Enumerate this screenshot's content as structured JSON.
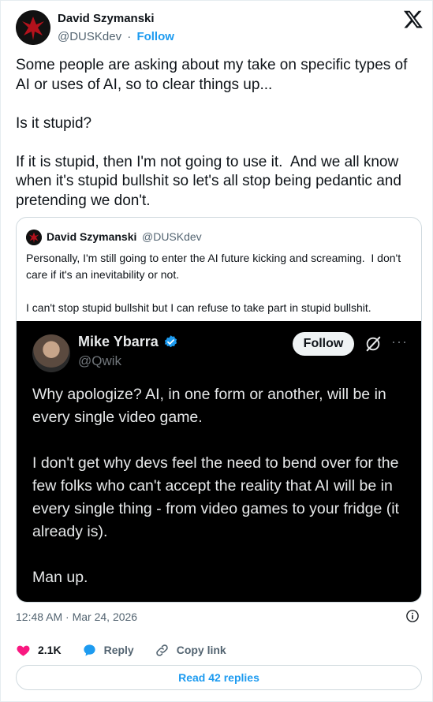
{
  "author": {
    "name": "David Szymanski",
    "handle": "@DUSKdev",
    "separator": "·",
    "follow_label": "Follow"
  },
  "tweet": {
    "text": "Some people are asking about my take on specific types of AI or uses of AI, so to clear things up...\n\nIs it stupid?\n\nIf it is stupid, then I'm not going to use it.  And we all know when it's stupid bullshit so let's all stop being pedantic and pretending we don't."
  },
  "quote": {
    "name": "David Szymanski",
    "handle": "@DUSKdev",
    "text": "Personally, I'm still going to enter the AI future kicking and screaming.  I don't care if it's an inevitability or not.\n\nI can't stop stupid bullshit but I can refuse to take part in stupid bullshit.",
    "embed": {
      "name": "Mike Ybarra",
      "handle": "@Qwik",
      "follow_label": "Follow",
      "more_label": "···",
      "text": "Why apologize? AI, in one form or another, will be in every single video game.\n\nI don't get why devs feel the need to bend over for the few folks who can't accept the reality that AI will be in every single thing - from video games to your fridge (it already is).\n\nMan up."
    }
  },
  "timestamp": "12:48 AM · Mar 24, 2026",
  "actions": {
    "likes": "2.1K",
    "reply_label": "Reply",
    "copy_label": "Copy link"
  },
  "read_replies_label": "Read 42 replies",
  "colors": {
    "accent": "#1d9bf0",
    "like": "#f91880",
    "text": "#0f1419",
    "muted": "#536471"
  },
  "icons": [
    "x-logo-icon",
    "verified-badge-icon",
    "grok-icon",
    "info-icon",
    "heart-icon",
    "reply-bubble-icon",
    "link-icon"
  ]
}
